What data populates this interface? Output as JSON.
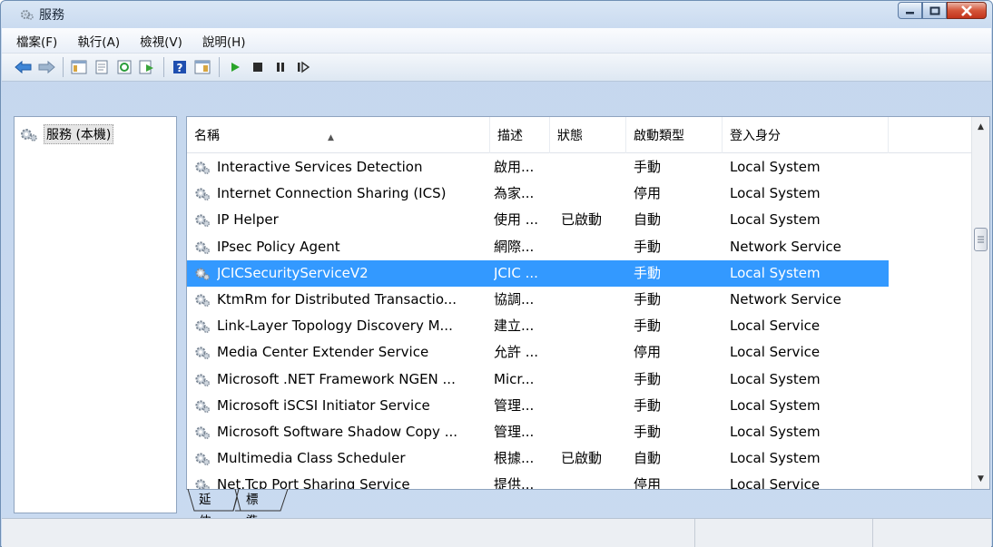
{
  "window": {
    "title": "服務"
  },
  "menu": [
    {
      "label": "檔案(F)"
    },
    {
      "label": "執行(A)"
    },
    {
      "label": "檢視(V)"
    },
    {
      "label": "說明(H)"
    }
  ],
  "tree": {
    "root_label": "服務 (本機)"
  },
  "table": {
    "columns": [
      "名稱",
      "描述",
      "狀態",
      "啟動類型",
      "登入身分"
    ],
    "rows": [
      {
        "name": "Interactive Services Detection",
        "desc": "啟用...",
        "status": "",
        "startup": "手動",
        "logon": "Local System"
      },
      {
        "name": "Internet Connection Sharing (ICS)",
        "desc": "為家...",
        "status": "",
        "startup": "停用",
        "logon": "Local System"
      },
      {
        "name": "IP Helper",
        "desc": "使用 ...",
        "status": "已啟動",
        "startup": "自動",
        "logon": "Local System"
      },
      {
        "name": "IPsec Policy Agent",
        "desc": "網際...",
        "status": "",
        "startup": "手動",
        "logon": "Network Service"
      },
      {
        "name": "JCICSecurityServiceV2",
        "desc": "JCIC ...",
        "status": "",
        "startup": "手動",
        "logon": "Local System",
        "selected": true
      },
      {
        "name": "KtmRm for Distributed Transactio...",
        "desc": "協調...",
        "status": "",
        "startup": "手動",
        "logon": "Network Service"
      },
      {
        "name": "Link-Layer Topology Discovery M...",
        "desc": "建立...",
        "status": "",
        "startup": "手動",
        "logon": "Local Service"
      },
      {
        "name": "Media Center Extender Service",
        "desc": "允許 ...",
        "status": "",
        "startup": "停用",
        "logon": "Local Service"
      },
      {
        "name": "Microsoft .NET Framework NGEN ...",
        "desc": "Micr...",
        "status": "",
        "startup": "手動",
        "logon": "Local System"
      },
      {
        "name": "Microsoft iSCSI Initiator Service",
        "desc": "管理...",
        "status": "",
        "startup": "手動",
        "logon": "Local System"
      },
      {
        "name": "Microsoft Software Shadow Copy ...",
        "desc": "管理...",
        "status": "",
        "startup": "手動",
        "logon": "Local System"
      },
      {
        "name": "Multimedia Class Scheduler",
        "desc": "根據...",
        "status": "已啟動",
        "startup": "自動",
        "logon": "Local System"
      },
      {
        "name": "Net.Tcp Port Sharing Service",
        "desc": "提供...",
        "status": "",
        "startup": "停用",
        "logon": "Local Service"
      }
    ]
  },
  "tabs": [
    {
      "label": "延伸"
    },
    {
      "label": "標準",
      "active": true
    }
  ],
  "colors": {
    "selection": "#3399ff",
    "play_green": "#2aa52a",
    "close_red": "#c2341b"
  }
}
